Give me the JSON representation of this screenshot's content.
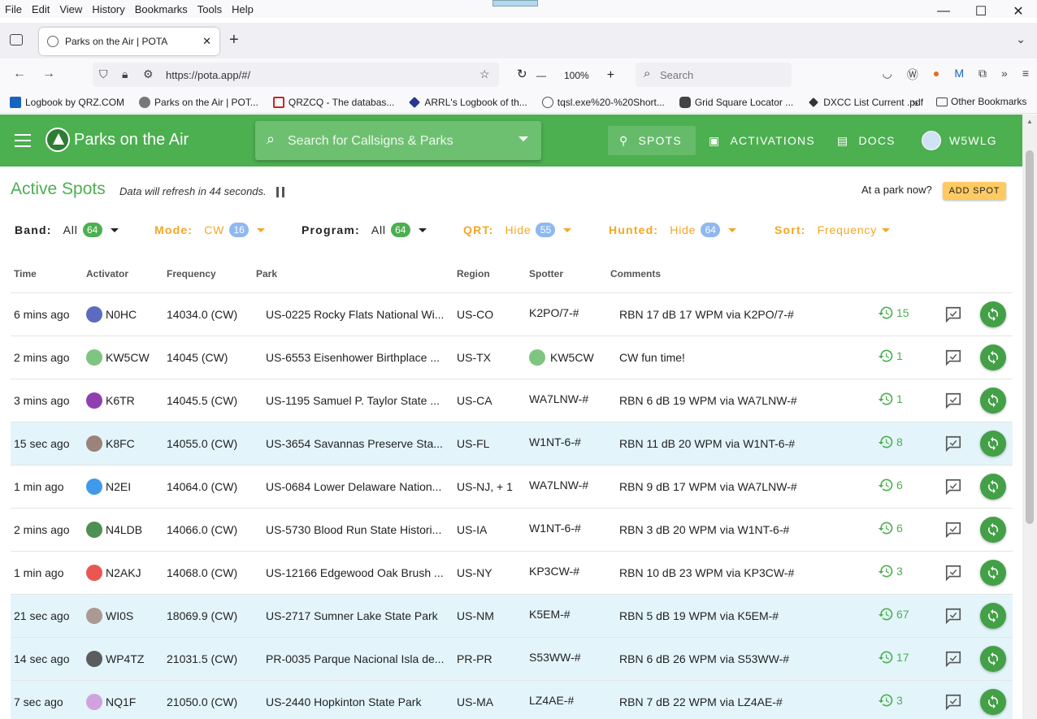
{
  "browser": {
    "menu": [
      "File",
      "Edit",
      "View",
      "History",
      "Bookmarks",
      "Tools",
      "Help"
    ],
    "tab_title": "Parks on the Air | POTA",
    "url": "https://pota.app/#/",
    "zoom": "100%",
    "search_placeholder": "Search",
    "bookmarks": [
      {
        "label": "Logbook by QRZ.COM",
        "color": "#1565c0"
      },
      {
        "label": "Parks on the Air | POT...",
        "color": "#777777"
      },
      {
        "label": "QRZCQ - The databas...",
        "color": "#c62828"
      },
      {
        "label": "ARRL's Logbook of th...",
        "color": "#283593"
      },
      {
        "label": "tqsl.exe%20-%20Short...",
        "color": "#555555"
      },
      {
        "label": "Grid Square Locator ...",
        "color": "#444444"
      },
      {
        "label": "DXCC List Current .pdf",
        "color": "#333333"
      }
    ],
    "other_bookmarks": "Other Bookmarks"
  },
  "app": {
    "title": "Parks on the Air",
    "search_placeholder": "Search for Callsigns & Parks",
    "nav": {
      "spots": "SPOTS",
      "activations": "ACTIVATIONS",
      "docs": "DOCS",
      "user": "W5WLG"
    }
  },
  "header": {
    "title": "Active Spots",
    "refresh": "Data will refresh in 44 seconds.",
    "at_park": "At a park now?",
    "add_spot": "ADD SPOT"
  },
  "filters": {
    "band": {
      "label": "Band:",
      "value": "All",
      "count": "64"
    },
    "mode": {
      "label": "Mode:",
      "value": "CW",
      "count": "16"
    },
    "program": {
      "label": "Program:",
      "value": "All",
      "count": "64"
    },
    "qrt": {
      "label": "QRT:",
      "value": "Hide",
      "count": "55"
    },
    "hunted": {
      "label": "Hunted:",
      "value": "Hide",
      "count": "64"
    },
    "sort": {
      "label": "Sort:",
      "value": "Frequency"
    }
  },
  "table": {
    "headers": {
      "time": "Time",
      "activator": "Activator",
      "frequency": "Frequency",
      "park": "Park",
      "region": "Region",
      "spotter": "Spotter",
      "comments": "Comments"
    },
    "rows": [
      {
        "time": "6 mins ago",
        "activator": "N0HC",
        "av": "#3f51b5",
        "frequency": "14034.0 (CW)",
        "park": "US-0225  Rocky Flats National Wi...",
        "region": "US-CO",
        "spotter": "K2PO/7-#",
        "spotter_av": "",
        "comment": "RBN 17 dB 17 WPM via K2PO/7-#",
        "hunts": "15",
        "highlight": false
      },
      {
        "time": "2 mins ago",
        "activator": "KW5CW",
        "av": "#66bb6a",
        "frequency": "14045 (CW)",
        "park": "US-6553  Eisenhower Birthplace ...",
        "region": "US-TX",
        "spotter": "KW5CW",
        "spotter_av": "#66bb6a",
        "comment": "CW fun time!",
        "hunts": "1",
        "highlight": false
      },
      {
        "time": "3 mins ago",
        "activator": "K6TR",
        "av": "#7b1fa2",
        "frequency": "14045.5 (CW)",
        "park": "US-1195  Samuel P. Taylor State ...",
        "region": "US-CA",
        "spotter": "WA7LNW-#",
        "spotter_av": "",
        "comment": "RBN 6 dB 19 WPM via WA7LNW-#",
        "hunts": "1",
        "highlight": false
      },
      {
        "time": "15 sec ago",
        "activator": "K8FC",
        "av": "#8d6e63",
        "frequency": "14055.0 (CW)",
        "park": "US-3654  Savannas Preserve Sta...",
        "region": "US-FL",
        "spotter": "W1NT-6-#",
        "spotter_av": "",
        "comment": "RBN 11 dB 20 WPM via W1NT-6-#",
        "hunts": "8",
        "highlight": true
      },
      {
        "time": "1 min ago",
        "activator": "N2EI",
        "av": "#1e88e5",
        "frequency": "14064.0 (CW)",
        "park": "US-0684  Lower Delaware Nation...",
        "region": "US-NJ, + 1",
        "spotter": "WA7LNW-#",
        "spotter_av": "",
        "comment": "RBN 9 dB 17 WPM via WA7LNW-#",
        "hunts": "6",
        "highlight": false
      },
      {
        "time": "2 mins ago",
        "activator": "N4LDB",
        "av": "#2e7d32",
        "frequency": "14066.0 (CW)",
        "park": "US-5730  Blood Run State Histori...",
        "region": "US-IA",
        "spotter": "W1NT-6-#",
        "spotter_av": "",
        "comment": "RBN 3 dB 20 WPM via W1NT-6-#",
        "hunts": "6",
        "highlight": false
      },
      {
        "time": "1 min ago",
        "activator": "N2AKJ",
        "av": "#e53935",
        "frequency": "14068.0 (CW)",
        "park": "US-12166  Edgewood Oak Brush ...",
        "region": "US-NY",
        "spotter": "KP3CW-#",
        "spotter_av": "",
        "comment": "RBN 10 dB 23 WPM via KP3CW-#",
        "hunts": "3",
        "highlight": false
      },
      {
        "time": "21 sec ago",
        "activator": "WI0S",
        "av": "#a1887f",
        "frequency": "18069.9 (CW)",
        "park": "US-2717  Sumner Lake State Park",
        "region": "US-NM",
        "spotter": "K5EM-#",
        "spotter_av": "",
        "comment": "RBN 5 dB 19 WPM via K5EM-#",
        "hunts": "67",
        "highlight": true
      },
      {
        "time": "14 sec ago",
        "activator": "WP4TZ",
        "av": "#424242",
        "frequency": "21031.5 (CW)",
        "park": "PR-0035  Parque Nacional Isla de...",
        "region": "PR-PR",
        "spotter": "S53WW-#",
        "spotter_av": "",
        "comment": "RBN 6 dB 26 WPM via S53WW-#",
        "hunts": "17",
        "highlight": true
      },
      {
        "time": "7 sec ago",
        "activator": "NQ1F",
        "av": "#ce93d8",
        "frequency": "21050.0 (CW)",
        "park": "US-2440  Hopkinton State Park",
        "region": "US-MA",
        "spotter": "LZ4AE-#",
        "spotter_av": "",
        "comment": "RBN 7 dB 22 WPM via LZ4AE-#",
        "hunts": "3",
        "highlight": true
      }
    ]
  }
}
